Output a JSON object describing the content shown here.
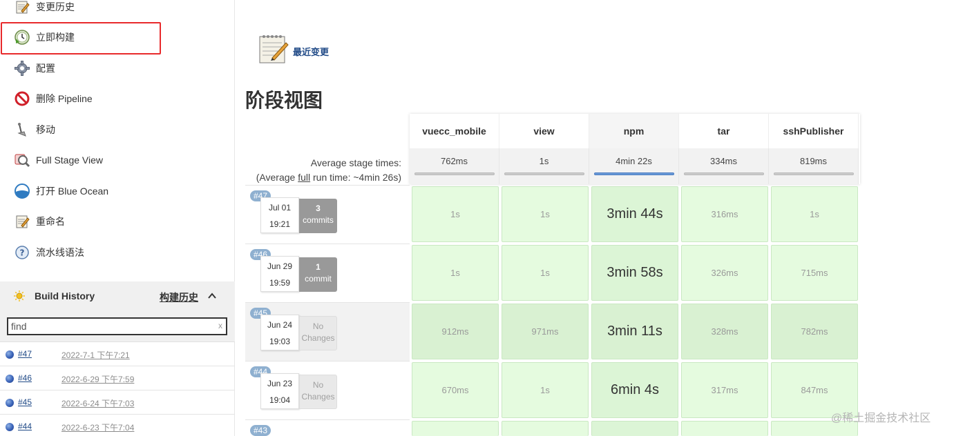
{
  "sidebar": {
    "tasks": [
      {
        "label": "变更历史",
        "icon": "notepad-icon"
      },
      {
        "label": "立即构建",
        "icon": "clock-build-icon"
      },
      {
        "label": "配置",
        "icon": "gear-icon"
      },
      {
        "label": "删除 Pipeline",
        "icon": "no-entry-icon"
      },
      {
        "label": "移动",
        "icon": "move-icon"
      },
      {
        "label": "Full Stage View",
        "icon": "magnifier-icon"
      },
      {
        "label": "打开 Blue Ocean",
        "icon": "blue-ocean-icon"
      },
      {
        "label": "重命名",
        "icon": "notepad-icon"
      },
      {
        "label": "流水线语法",
        "icon": "help-icon"
      }
    ],
    "build_history": {
      "title": "Build History",
      "title_cn": "构建历史",
      "filter_value": "find",
      "clear_glyph": "x",
      "rows": [
        {
          "number": "#47",
          "date": "2022-7-1 下午7:21"
        },
        {
          "number": "#46",
          "date": "2022-6-29 下午7:59"
        },
        {
          "number": "#45",
          "date": "2022-6-24 下午7:03"
        },
        {
          "number": "#44",
          "date": "2022-6-23 下午7:04"
        }
      ]
    }
  },
  "main": {
    "recent_changes": "最近变更",
    "stage_view_title": "阶段视图",
    "avg_label_line1": "Average stage times:",
    "avg_label_line2_a": "(Average ",
    "avg_label_line2_link": "full",
    "avg_label_line2_b": " run time: ~4min 26s)",
    "stages": [
      {
        "name": "vuecc_mobile",
        "avg": "762ms"
      },
      {
        "name": "view",
        "avg": "1s"
      },
      {
        "name": "npm",
        "avg": "4min 22s"
      },
      {
        "name": "tar",
        "avg": "334ms"
      },
      {
        "name": "sshPublisher",
        "avg": "819ms"
      }
    ],
    "builds": [
      {
        "badge": "#47",
        "date": "Jul 01",
        "time": "19:21",
        "changes_count": "3",
        "changes_word": "commits",
        "durations": [
          "1s",
          "1s",
          "3min 44s",
          "316ms",
          "1s"
        ]
      },
      {
        "badge": "#46",
        "date": "Jun 29",
        "time": "19:59",
        "changes_count": "1",
        "changes_word": "commit",
        "durations": [
          "1s",
          "1s",
          "3min 58s",
          "326ms",
          "715ms"
        ]
      },
      {
        "badge": "#45",
        "date": "Jun 24",
        "time": "19:03",
        "changes_count": "No",
        "changes_word": "Changes",
        "durations": [
          "912ms",
          "971ms",
          "3min 11s",
          "328ms",
          "782ms"
        ]
      },
      {
        "badge": "#44",
        "date": "Jun 23",
        "time": "19:04",
        "changes_count": "No",
        "changes_word": "Changes",
        "durations": [
          "670ms",
          "1s",
          "6min 4s",
          "317ms",
          "847ms"
        ]
      },
      {
        "badge": "#43"
      }
    ]
  },
  "watermark": "@稀土掘金技术社区",
  "colors": {
    "highlight": "#e8292b",
    "link": "#204a87",
    "stage_success": "#e5fbdf"
  }
}
